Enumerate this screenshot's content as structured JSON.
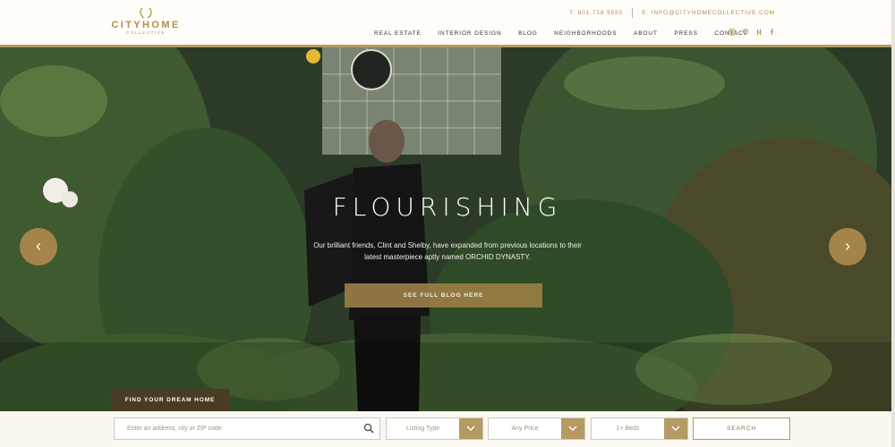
{
  "brand": {
    "name": "CITYHOME",
    "tagline": "COLLECTIVE",
    "color": "#b08f4a"
  },
  "top_info": {
    "phone": "T: 801.718.5555",
    "email": "E: INFO@CITYHOMECOLLECTIVE.COM"
  },
  "nav": [
    "REAL ESTATE",
    "INTERIOR DESIGN",
    "BLOG",
    "NEIGHBORHOODS",
    "ABOUT",
    "PRESS",
    "CONTACT"
  ],
  "social_icons": [
    "instagram-icon",
    "pinterest-icon",
    "houzz-icon",
    "facebook-icon"
  ],
  "hero": {
    "title": "FLOURISHING",
    "description": "Our brilliant friends, Clint and Shelby, have expanded from previous locations to their latest masterpiece aptly named ORCHID DYNASTY.",
    "cta": "SEE FULL BLOG HERE",
    "prev_icon": "‹",
    "next_icon": "›"
  },
  "find_tab": "FIND YOUR DREAM HOME",
  "search": {
    "address_placeholder": "Enter an address, city or ZIP code",
    "listing_type": "Listing Type",
    "price": "Any Price",
    "beds": "1+ Beds",
    "button": "SEARCH"
  },
  "colors": {
    "accent": "#b59a64",
    "dark_tab": "#4a3b22",
    "cta": "#9a7d45"
  }
}
